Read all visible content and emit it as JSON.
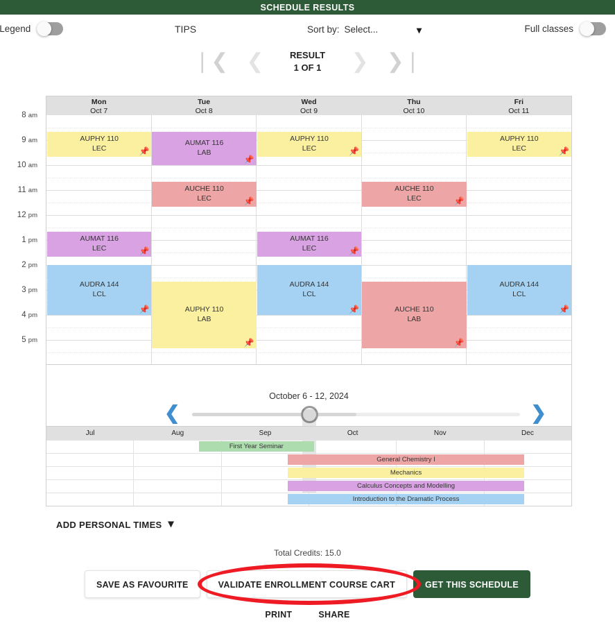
{
  "banner": {
    "title": "SCHEDULE RESULTS"
  },
  "options": {
    "legend_label": "e Legend",
    "legend_toggle": "off",
    "tips_label": "TIPS",
    "sort_label": "Sort by:",
    "sort_value": "Select...",
    "sort_caret": "chevron-down-icon",
    "full_classes_label": "Full classes",
    "full_classes_toggle": "off"
  },
  "pager": {
    "first": "|<",
    "prev": "<",
    "next": ">",
    "last": ">|",
    "result_label": "RESULT",
    "result_count": "1 OF 1"
  },
  "calendar": {
    "days": [
      {
        "weekday": "Mon",
        "date": "Oct 7"
      },
      {
        "weekday": "Tue",
        "date": "Oct 8"
      },
      {
        "weekday": "Wed",
        "date": "Oct 9"
      },
      {
        "weekday": "Thu",
        "date": "Oct 10"
      },
      {
        "weekday": "Fri",
        "date": "Oct 11"
      }
    ],
    "hours": [
      {
        "label": "8",
        "suffix": "am"
      },
      {
        "label": "9",
        "suffix": "am"
      },
      {
        "label": "10",
        "suffix": "am"
      },
      {
        "label": "11",
        "suffix": "am"
      },
      {
        "label": "12",
        "suffix": "pm"
      },
      {
        "label": "1",
        "suffix": "pm"
      },
      {
        "label": "2",
        "suffix": "pm"
      },
      {
        "label": "3",
        "suffix": "pm"
      },
      {
        "label": "4",
        "suffix": "pm"
      },
      {
        "label": "5",
        "suffix": "pm"
      }
    ],
    "colors": {
      "yellow": "#faf0a0",
      "purple": "#d9a3e3",
      "red": "#eda5a5",
      "blue": "#a5d2f2",
      "green": "#addcae"
    },
    "events": [
      {
        "course": "AUPHY 110",
        "type": "LEC",
        "day": 0,
        "start": 8.66,
        "end": 9.66,
        "color": "#faf0a0",
        "pin": true
      },
      {
        "course": "AUMAT 116",
        "type": "LAB",
        "day": 1,
        "start": 8.66,
        "end": 10.0,
        "color": "#d9a3e3",
        "pin": true
      },
      {
        "course": "AUPHY 110",
        "type": "LEC",
        "day": 2,
        "start": 8.66,
        "end": 9.66,
        "color": "#faf0a0",
        "pin": true
      },
      {
        "course": "AUPHY 110",
        "type": "LEC",
        "day": 4,
        "start": 8.66,
        "end": 9.66,
        "color": "#faf0a0",
        "pin": true
      },
      {
        "course": "AUCHE 110",
        "type": "LEC",
        "day": 1,
        "start": 10.66,
        "end": 11.66,
        "color": "#eda5a5",
        "pin": true
      },
      {
        "course": "AUCHE 110",
        "type": "LEC",
        "day": 3,
        "start": 10.66,
        "end": 11.66,
        "color": "#eda5a5",
        "pin": true
      },
      {
        "course": "AUMAT 116",
        "type": "LEC",
        "day": 0,
        "start": 12.66,
        "end": 13.66,
        "color": "#d9a3e3",
        "pin": true
      },
      {
        "course": "AUMAT 116",
        "type": "LEC",
        "day": 2,
        "start": 12.66,
        "end": 13.66,
        "color": "#d9a3e3",
        "pin": true
      },
      {
        "course": "AUDRA 144",
        "type": "LCL",
        "day": 0,
        "start": 14.0,
        "end": 16.0,
        "color": "#a5d2f2",
        "pin": true
      },
      {
        "course": "AUDRA 144",
        "type": "LCL",
        "day": 2,
        "start": 14.0,
        "end": 16.0,
        "color": "#a5d2f2",
        "pin": true
      },
      {
        "course": "AUDRA 144",
        "type": "LCL",
        "day": 4,
        "start": 14.0,
        "end": 16.0,
        "color": "#a5d2f2",
        "pin": true
      },
      {
        "course": "AUPHY 110",
        "type": "LAB",
        "day": 1,
        "start": 14.66,
        "end": 17.33,
        "color": "#faf0a0",
        "pin": true
      },
      {
        "course": "AUCHE 110",
        "type": "LAB",
        "day": 3,
        "start": 14.66,
        "end": 17.33,
        "color": "#eda5a5",
        "pin": true
      }
    ]
  },
  "range": {
    "label": "October 6 - 12, 2024",
    "prev_icon": "chevron-left-icon",
    "next_icon": "chevron-right-icon",
    "slider_position_pct": 50
  },
  "timeline": {
    "months": [
      "Jul",
      "Aug",
      "Sep",
      "Oct",
      "Nov",
      "Dec"
    ],
    "courses": [
      {
        "name": "First Year Seminar",
        "start_pct": 29.0,
        "end_pct": 51.0,
        "color": "#addcae"
      },
      {
        "name": "General Chemistry I",
        "start_pct": 46.0,
        "end_pct": 91.0,
        "color": "#eda5a5"
      },
      {
        "name": "Mechanics",
        "start_pct": 46.0,
        "end_pct": 91.0,
        "color": "#faf0a0"
      },
      {
        "name": "Calculus Concepts and Modelling",
        "start_pct": 46.0,
        "end_pct": 91.0,
        "color": "#d9a3e3"
      },
      {
        "name": "Introduction to the Dramatic Process",
        "start_pct": 46.0,
        "end_pct": 91.0,
        "color": "#a5d2f2"
      }
    ]
  },
  "footer": {
    "add_personal_times": "ADD PERSONAL TIMES",
    "add_personal_caret": "chevron-down-icon",
    "total_credits": "Total Credits: 15.0",
    "save_favourite": "SAVE AS FAVOURITE",
    "validate_cart": "VALIDATE ENROLLMENT COURSE CART",
    "get_schedule": "GET THIS SCHEDULE",
    "print": "PRINT",
    "share": "SHARE",
    "highlight_color": "#ee1b24"
  }
}
